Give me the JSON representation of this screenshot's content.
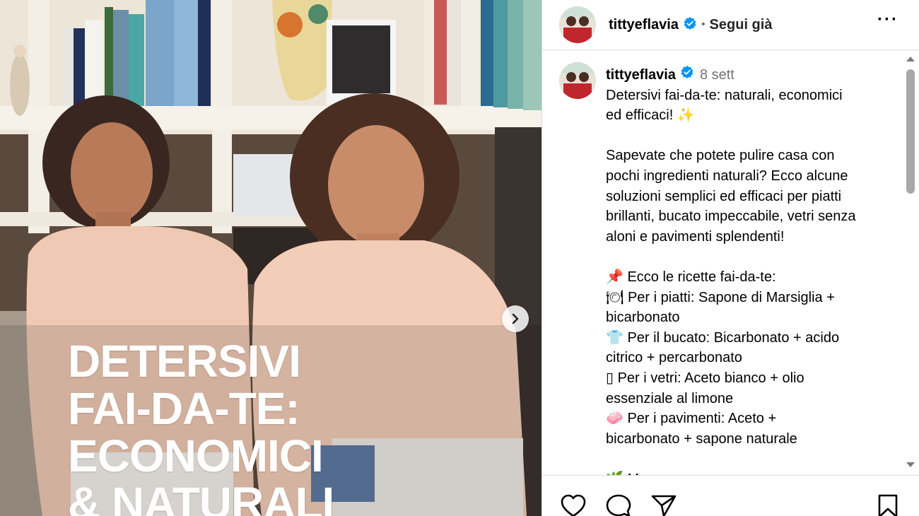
{
  "post_image": {
    "overlay_lines": [
      "DETERSIVI",
      "FAI-DA-TE:",
      "ECONOMICI",
      "& NATURALI"
    ]
  },
  "header": {
    "username": "tittyeflavia",
    "separator": "•",
    "follow_label": "Segui già",
    "more_label": "···"
  },
  "caption": {
    "username": "tittyeflavia",
    "time": "8 sett",
    "lines": [
      "Detersivi fai-da-te: naturali, economici",
      "ed efficaci! ✨",
      "",
      "Sapevate che potete pulire casa con",
      "pochi ingredienti naturali? Ecco alcune",
      "soluzioni semplici ed efficaci per piatti",
      "brillanti, bucato impeccabile, vetri senza",
      "aloni e pavimenti splendenti!",
      "",
      "📌 Ecco le ricette fai-da-te:",
      "🍽 Per i piatti: Sapone di Marsiglia +",
      "bicarbonato",
      "👕 Per il bucato: Bicarbonato + acido",
      "citrico + percarbonato",
      "▯ Per i vetri: Aceto bianco + olio",
      "essenziale al limone",
      "🧼 Per i pavimenti: Aceto +",
      "bicarbonato + sapone naturale",
      "",
      "🌿 M"
    ]
  },
  "colors": {
    "verified": "#0095f6",
    "secondary_text": "#737373",
    "divider": "#dbdbdb"
  },
  "icons": {
    "like": "heart-icon",
    "comment": "comment-icon",
    "share": "paper-plane-icon",
    "save": "bookmark-icon",
    "next": "chevron-right-icon"
  }
}
